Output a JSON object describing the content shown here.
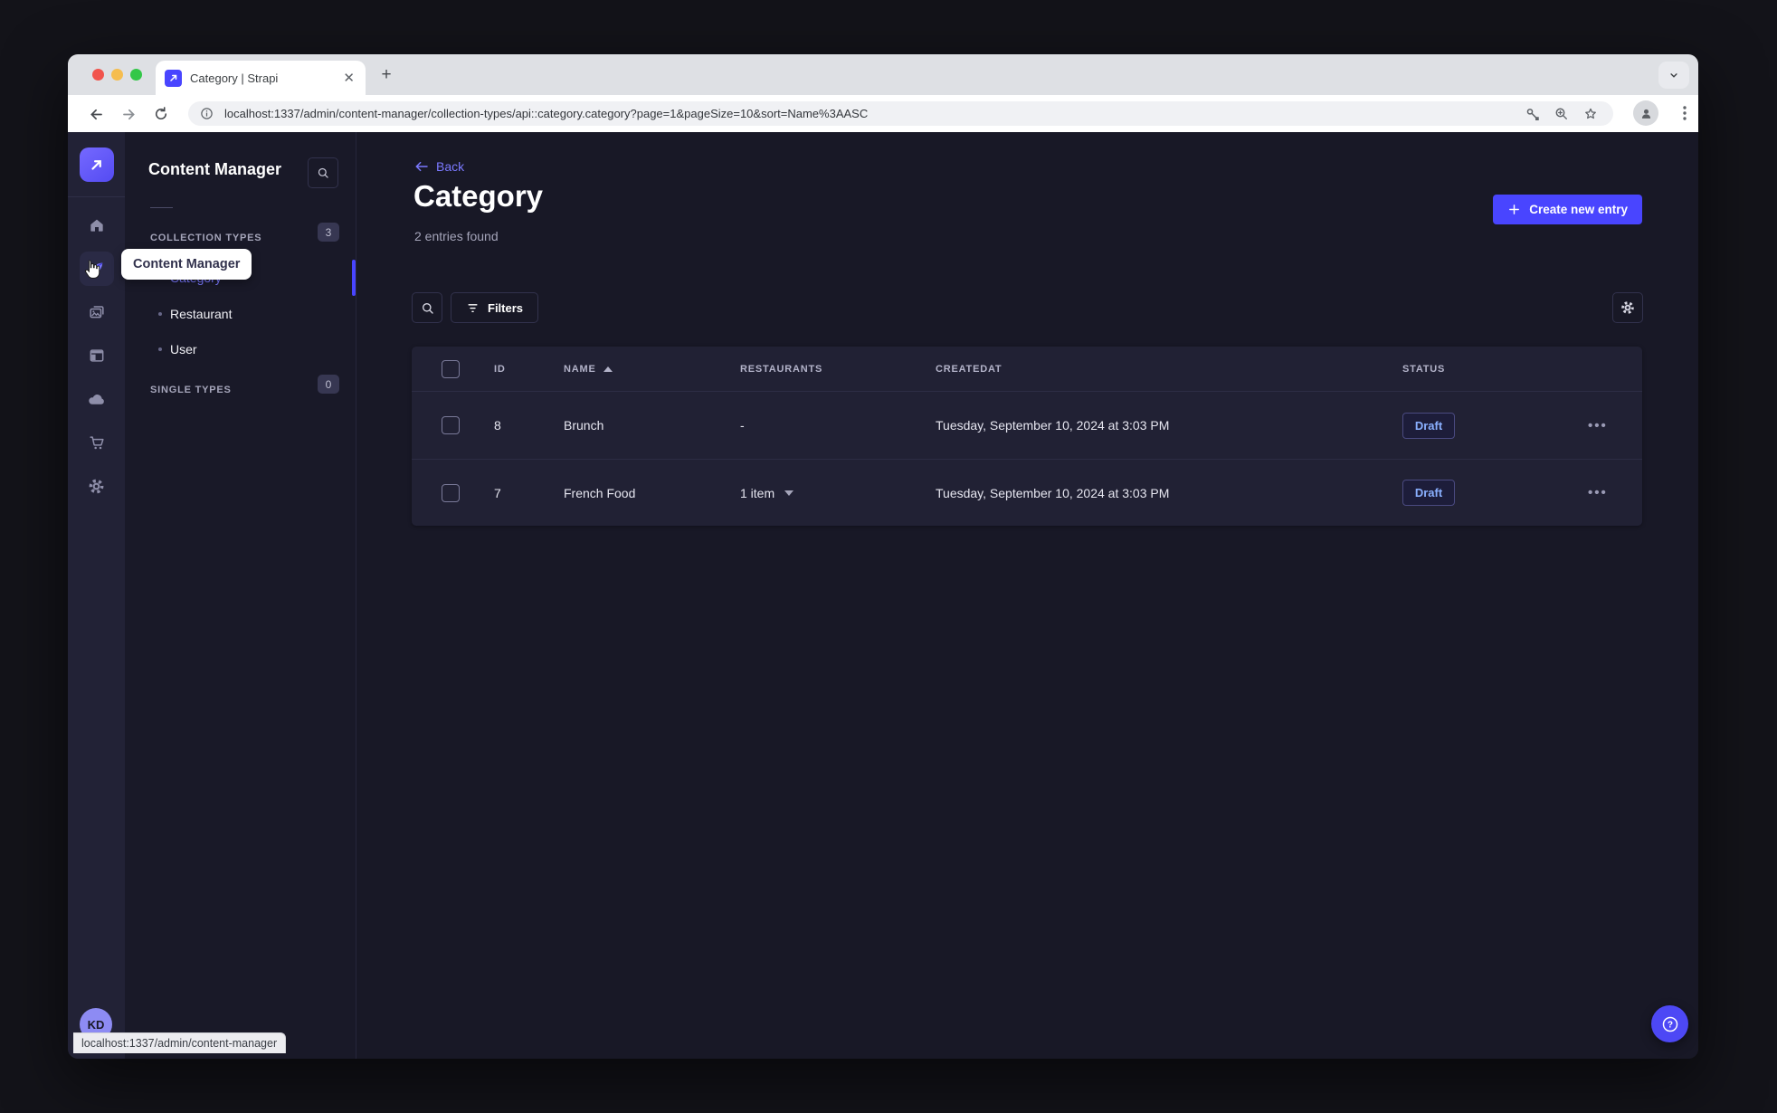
{
  "browser": {
    "tab_title": "Category | Strapi",
    "new_tab_label": "+",
    "url": "localhost:1337/admin/content-manager/collection-types/api::category.category?page=1&pageSize=10&sort=Name%3AASC",
    "status_tooltip": "localhost:1337/admin/content-manager"
  },
  "nav": {
    "tooltip": "Content Manager",
    "avatar_initials": "KD",
    "icons": [
      "strapi-logo-icon",
      "home-icon",
      "content-manager-icon",
      "media-library-icon",
      "content-type-builder-icon",
      "cloud-icon",
      "marketplace-icon",
      "settings-icon"
    ]
  },
  "subnav": {
    "title": "Content Manager",
    "collection_types": {
      "label": "COLLECTION TYPES",
      "count": "3"
    },
    "items": [
      {
        "label": "Category",
        "active": true
      },
      {
        "label": "Restaurant",
        "active": false
      },
      {
        "label": "User",
        "active": false
      }
    ],
    "single_types": {
      "label": "SINGLE TYPES",
      "count": "0"
    }
  },
  "header": {
    "back_label": "Back",
    "title": "Category",
    "subtitle": "2 entries found",
    "create_label": "Create new entry"
  },
  "toolbar": {
    "filters_label": "Filters"
  },
  "table": {
    "columns": [
      "ID",
      "NAME",
      "RESTAURANTS",
      "CREATEDAT",
      "STATUS"
    ],
    "rows": [
      {
        "id": "8",
        "name": "Brunch",
        "restaurants": "-",
        "createdAt": "Tuesday, September 10, 2024 at 3:03 PM",
        "status": "Draft"
      },
      {
        "id": "7",
        "name": "French Food",
        "restaurants": "1 item",
        "createdAt": "Tuesday, September 10, 2024 at 3:03 PM",
        "status": "Draft"
      }
    ]
  },
  "colors": {
    "accent": "#4945ff",
    "accent_text": "#7b79ff",
    "surface": "#212134",
    "background": "#181826",
    "draft_text": "#8ab0ff"
  },
  "icons": {
    "search": "magnifier",
    "filters": "funnel-lines",
    "settings": "gear",
    "help": "circled-question-mark",
    "sort": "triangle-up",
    "relation": "triangle-down",
    "more": "ellipsis",
    "back": "left-arrow",
    "create": "plus",
    "browser": [
      "key",
      "zoom-magnifier",
      "bookmark-star",
      "profile-person",
      "kebab-menu"
    ]
  }
}
